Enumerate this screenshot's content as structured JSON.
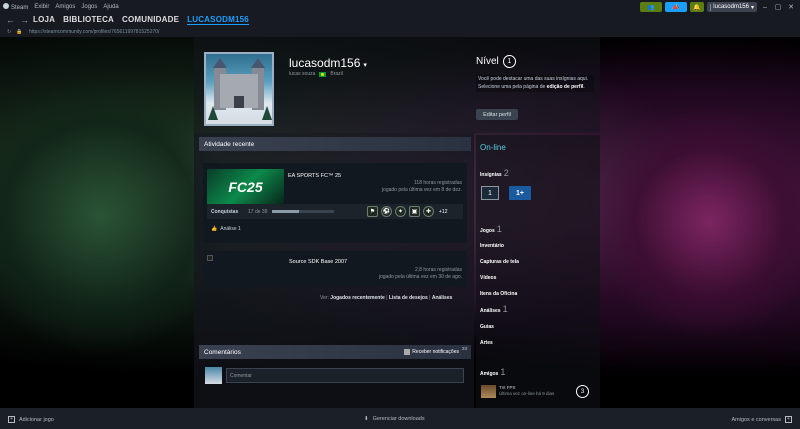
{
  "titlebar": {
    "menu": [
      "Steam",
      "Exibir",
      "Amigos",
      "Jogos",
      "Ajuda"
    ],
    "username": "lucasodm156"
  },
  "nav": {
    "links": [
      "LOJA",
      "BIBLIOTECA",
      "COMUNIDADE",
      "LUCASODM156"
    ],
    "url": "https://steamcommunity.com/profiles/76561199781525270/"
  },
  "profile": {
    "name": "lucasodm156",
    "real_name": "lucas souza",
    "country": "Brazil",
    "level_label": "Nível",
    "level": "1",
    "level_desc": "Você pode destacar uma das suas insígnias aqui. Selecione uma pela página de",
    "level_desc_bold": "edição de perfil",
    "edit_button": "Editar perfil"
  },
  "activity": {
    "header": "Atividade recente",
    "games": [
      {
        "name": "EA SPORTS FC™ 25",
        "art_text": "FC25",
        "hours": "118 horas registradas",
        "last": "jogado pela última vez em 8 de dez.",
        "ach_label": "Conquistas",
        "ach_count": "17 de 39",
        "ach_progress": 0.44,
        "ach_more": "+12",
        "review": "Análise 1"
      },
      {
        "name": "Source SDK Base 2007",
        "hours": "2,8 horas registradas",
        "last": "jogado pela última vez em 30 de ago."
      }
    ],
    "links_prefix": "Ver:",
    "links": [
      "Jogados recentemente",
      "Lista de desejos",
      "Análises"
    ]
  },
  "comments": {
    "header": "Comentários",
    "notify": "Receber notificações",
    "count": "23",
    "placeholder": "Comentar"
  },
  "sidebar": {
    "status": "On-line",
    "badges_label": "Insígnias",
    "badges_count": "2",
    "badge1": "1",
    "badge2": "1+",
    "items": [
      {
        "label": "Jogos",
        "count": "1"
      },
      {
        "label": "Inventário",
        "count": ""
      },
      {
        "label": "Capturas de tela",
        "count": ""
      },
      {
        "label": "Vídeos",
        "count": ""
      },
      {
        "label": "Itens da Oficina",
        "count": ""
      },
      {
        "label": "Análises",
        "count": "1"
      },
      {
        "label": "Guias",
        "count": ""
      },
      {
        "label": "Artes",
        "count": ""
      }
    ],
    "friends_label": "Amigos",
    "friends_count": "1",
    "friend_name": "Tnt FPS",
    "friend_status": "Última vez on-line há 9 dias",
    "friends_total": "3"
  },
  "bottom": {
    "add_game": "Adicionar jogo",
    "downloads": "Gerenciar downloads",
    "friends": "Amigos e conversas"
  },
  "colors": {
    "accent": "#1a9fff",
    "online": "#57cbde",
    "bg": "#171a21"
  }
}
